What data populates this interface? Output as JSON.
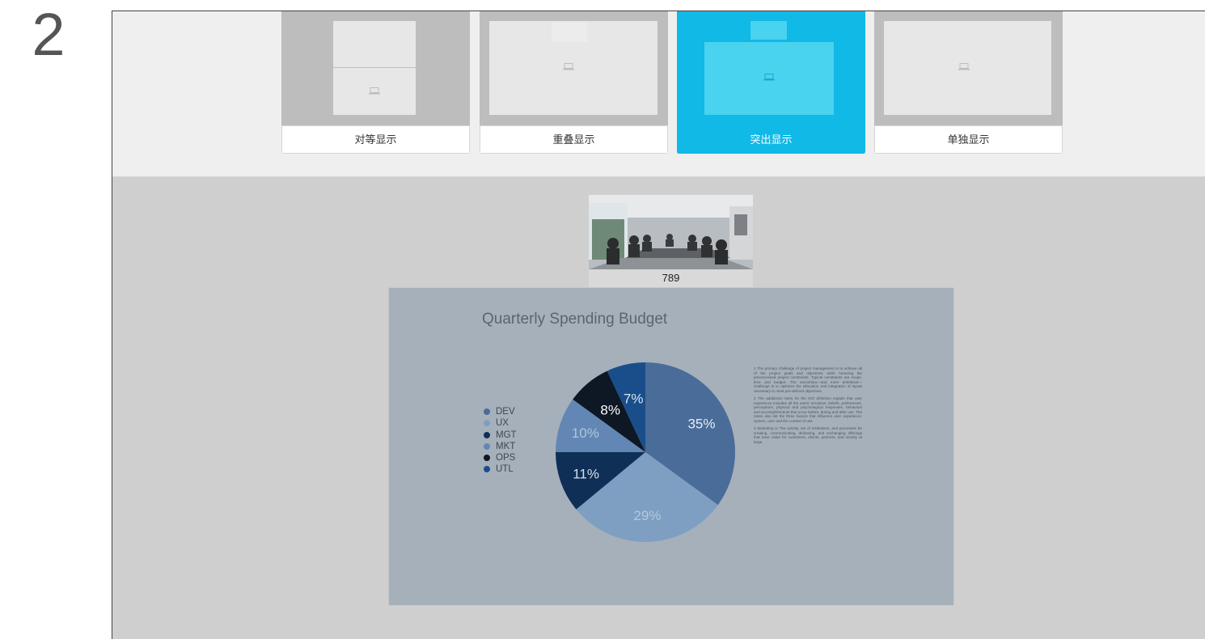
{
  "step_number": "2",
  "layouts": [
    {
      "label": "对等显示",
      "selected": false
    },
    {
      "label": "重叠显示",
      "selected": false
    },
    {
      "label": "突出显示",
      "selected": true
    },
    {
      "label": "单独显示",
      "selected": false
    }
  ],
  "participant": {
    "label": "789"
  },
  "presentation": {
    "title": "Quarterly Spending Budget",
    "notes": [
      "1 The primary challenge of project management is to achieve all of the project goals and objectives while honoring the preconceived project constraints. Typical constraints are scope, time and budget. The secondary—and more ambitious—challenge is to optimize the allocation and integration of inputs necessary to meet pre-defined objectives.",
      "2 The additional notes for the ISO definition explain that user experience includes all the users' emotions, beliefs, preferences, perceptions, physical and psychological responses, behaviors and accomplishments that occur before, during and after use. The notes also list the three factors that influence user experience: system, user and the context of use.",
      "3 Marketing is \"the activity, set of institutions, and processes for creating, communicating, delivering, and exchanging offerings that have value for customers, clients, partners, and society at large."
    ]
  },
  "chart_data": {
    "type": "pie",
    "title": "Quarterly Spending Budget",
    "categories": [
      "DEV",
      "UX",
      "MGT",
      "MKT",
      "OPS",
      "UTL"
    ],
    "values": [
      35,
      29,
      11,
      10,
      8,
      7
    ],
    "labels": [
      "35%",
      "29%",
      "11%",
      "10%",
      "8%",
      "7%"
    ],
    "colors": [
      "#4a6c99",
      "#7e9fc2",
      "#0f2f57",
      "#6287b4",
      "#0e1724",
      "#1a4e8b"
    ],
    "label_colors": [
      "#e6ecf3",
      "#b4c8dc",
      "#d6e0ec",
      "#b2c6dc",
      "#ffffff",
      "#dbe6f2"
    ],
    "legend_position": "left"
  }
}
